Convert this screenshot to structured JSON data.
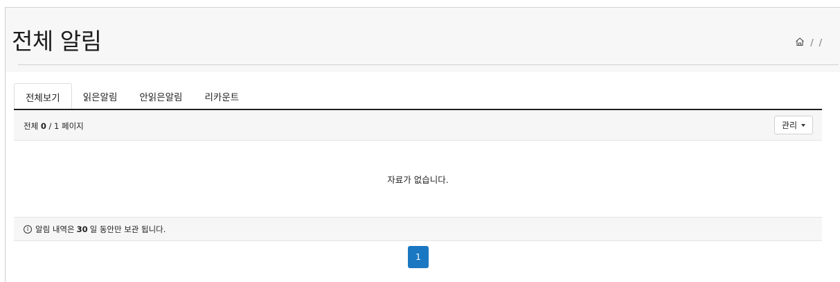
{
  "header": {
    "title": "전체 알림",
    "breadcrumb": {
      "home_icon": "home-icon",
      "separator": "/"
    }
  },
  "tabs": [
    {
      "label": "전체보기",
      "active": true
    },
    {
      "label": "읽은알림",
      "active": false
    },
    {
      "label": "안읽은알림",
      "active": false
    },
    {
      "label": "리카운트",
      "active": false
    }
  ],
  "list": {
    "count_prefix": "전체 ",
    "count_value": "0",
    "count_suffix": " / 1 페이지",
    "manage_label": "관리",
    "empty_message": "자료가 없습니다."
  },
  "notice": {
    "icon": "info-icon",
    "text_before": "알림 내역은 ",
    "days": "30",
    "text_after": "일 동안만 보관 됩니다."
  },
  "pagination": {
    "current_page": "1"
  },
  "colors": {
    "accent": "#1a78c2",
    "tab_border": "#1f1f1f"
  }
}
